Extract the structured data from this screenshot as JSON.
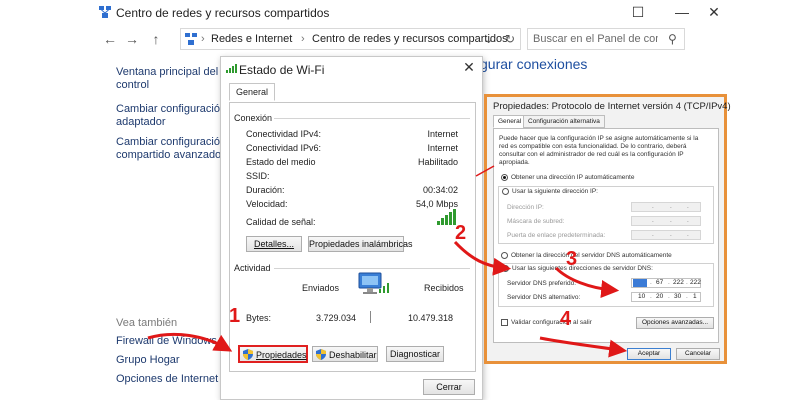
{
  "window": {
    "title": "Centro de redes y recursos compartidos",
    "controls": {
      "minimize": "—",
      "maximize": "☐",
      "close": "✕"
    }
  },
  "address_bar": {
    "back": "←",
    "forward": "→",
    "up": "↑",
    "breadcrumb_sep": "›",
    "breadcrumbs": [
      "Redes e Internet",
      "Centro de redes y recursos compartidos"
    ],
    "dropdown": "⌄",
    "refresh": "↻",
    "search_placeholder": "Buscar en el Panel de control",
    "search_icon": "⚲"
  },
  "sidebar": {
    "links": [
      {
        "line1": "Ventana principal del Pa",
        "line2": "control"
      },
      {
        "line1": "Cambiar configuración d",
        "line2": "adaptador"
      },
      {
        "line1": "Cambiar configuración d",
        "line2": "compartido avanzado"
      }
    ],
    "see_also_heading": "Vea también",
    "see_also": [
      "Firewall de Windows",
      "Grupo Hogar",
      "Opciones de Internet"
    ]
  },
  "main": {
    "heading_partial": "gurar conexiones"
  },
  "wifi_dialog": {
    "title": "Estado de Wi-Fi",
    "close": "✕",
    "tab": "General",
    "connection_heading": "Conexión",
    "connection_rows": [
      {
        "label": "Conectividad IPv4:",
        "value": "Internet"
      },
      {
        "label": "Conectividad IPv6:",
        "value": "Internet"
      },
      {
        "label": "Estado del medio",
        "value": "Habilitado"
      },
      {
        "label": "SSID:",
        "value": ""
      },
      {
        "label": "Duración:",
        "value": "00:34:02"
      },
      {
        "label": "Velocidad:",
        "value": "54,0 Mbps"
      }
    ],
    "signal_label": "Calidad de señal:",
    "signal_level": 5,
    "signal_max": 5,
    "details_button": "Detalles...",
    "wireless_props_button": "Propiedades inalámbricas",
    "activity_heading": "Actividad",
    "sent_label": "Enviados",
    "received_label": "Recibidos",
    "bytes_label": "Bytes:",
    "bytes_sent": "3.729.034",
    "bytes_received": "10.479.318",
    "properties_button": "Propiedades",
    "disable_button": "Deshabilitar",
    "diagnose_button": "Diagnosticar",
    "close_button": "Cerrar"
  },
  "ipv4_dialog": {
    "title": "Propiedades: Protocolo de Internet versión 4 (TCP/IPv4)",
    "tab_general": "General",
    "tab_alt": "Configuración alternativa",
    "description": [
      "Puede hacer que la configuración IP se asigne automáticamente si la",
      "red es compatible con esta funcionalidad. De lo contrario, deberá",
      "consultar con el administrador de red cuál es la configuración IP",
      "apropiada."
    ],
    "radio_auto_ip": "Obtener una dirección IP automáticamente",
    "radio_manual_ip": "Usar la siguiente dirección IP:",
    "ip_label": "Dirección IP:",
    "mask_label": "Máscara de subred:",
    "gateway_label": "Puerta de enlace predeterminada:",
    "radio_auto_dns": "Obtener la dirección del servidor DNS automáticamente",
    "radio_manual_dns": "Usar las siguientes direcciones de servidor DNS:",
    "dns_pref_label": "Servidor DNS preferido:",
    "dns_alt_label": "Servidor DNS alternativo:",
    "dns_pref": [
      "",
      "67",
      "222",
      "222"
    ],
    "dns_alt": [
      "10",
      "20",
      "30",
      "1"
    ],
    "validate_label": "Validar configuración al salir",
    "advanced_button": "Opciones avanzadas...",
    "ok_button": "Aceptar",
    "cancel_button": "Cancelar"
  },
  "callouts": [
    "1",
    "2",
    "3",
    "4"
  ],
  "colors": {
    "callout": "#e01818",
    "dialog_border": "#e8913a",
    "link": "#1e3a6e",
    "heading": "#1e4fa0"
  }
}
